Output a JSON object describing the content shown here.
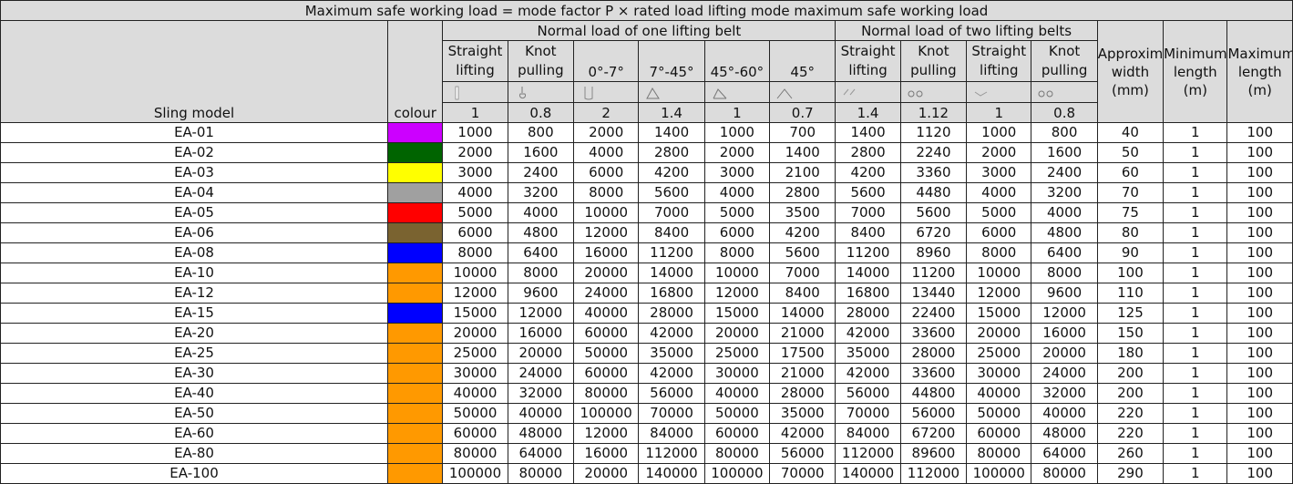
{
  "title": "Maximum safe working load = mode factor P × rated load lifting mode maximum safe working load",
  "groups": {
    "one_belt": "Normal load of one lifting belt",
    "two_belts": "Normal load of two lifting belts"
  },
  "headers": {
    "model": "Sling model",
    "colour": "colour",
    "width": "Approximate width (mm)",
    "min_length": "Minimum length (m)",
    "max_length": "Maximum length (m)"
  },
  "modes": [
    {
      "label": "Straight lifting",
      "factor": "1",
      "icon": "straight-lift-icon"
    },
    {
      "label": "Knot pulling",
      "factor": "0.8",
      "icon": "knot-pull-icon"
    },
    {
      "label": "0°-7°",
      "factor": "2",
      "icon": "basket-0-7-icon"
    },
    {
      "label": "7°-45°",
      "factor": "1.4",
      "icon": "basket-7-45-icon"
    },
    {
      "label": "45°-60°",
      "factor": "1",
      "icon": "basket-45-60-icon"
    },
    {
      "label": "45°",
      "factor": "0.7",
      "icon": "basket-45-icon"
    },
    {
      "label": "Straight lifting",
      "factor": "1.4",
      "icon": "two-straight-lift-icon"
    },
    {
      "label": "Knot pulling",
      "factor": "1.12",
      "icon": "two-knot-pull-icon"
    },
    {
      "label": "Straight lifting",
      "factor": "1",
      "icon": "two-straight-lift-b-icon"
    },
    {
      "label": "Knot pulling",
      "factor": "0.8",
      "icon": "two-knot-pull-b-icon"
    }
  ],
  "rows": [
    {
      "model": "EA-01",
      "color": "#cc00ff",
      "v": [
        "1000",
        "800",
        "2000",
        "1400",
        "1000",
        "700",
        "1400",
        "1120",
        "1000",
        "800"
      ],
      "width": "40",
      "min": "1",
      "max": "100"
    },
    {
      "model": "EA-02",
      "color": "#006400",
      "v": [
        "2000",
        "1600",
        "4000",
        "2800",
        "2000",
        "1400",
        "2800",
        "2240",
        "2000",
        "1600"
      ],
      "width": "50",
      "min": "1",
      "max": "100"
    },
    {
      "model": "EA-03",
      "color": "#ffff00",
      "v": [
        "3000",
        "2400",
        "6000",
        "4200",
        "3000",
        "2100",
        "4200",
        "3360",
        "3000",
        "2400"
      ],
      "width": "60",
      "min": "1",
      "max": "100"
    },
    {
      "model": "EA-04",
      "color": "#a0a0a0",
      "v": [
        "4000",
        "3200",
        "8000",
        "5600",
        "4000",
        "2800",
        "5600",
        "4480",
        "4000",
        "3200"
      ],
      "width": "70",
      "min": "1",
      "max": "100"
    },
    {
      "model": "EA-05",
      "color": "#ff0000",
      "v": [
        "5000",
        "4000",
        "10000",
        "7000",
        "5000",
        "3500",
        "7000",
        "5600",
        "5000",
        "4000"
      ],
      "width": "75",
      "min": "1",
      "max": "100"
    },
    {
      "model": "EA-06",
      "color": "#7a6330",
      "v": [
        "6000",
        "4800",
        "12000",
        "8400",
        "6000",
        "4200",
        "8400",
        "6720",
        "6000",
        "4800"
      ],
      "width": "80",
      "min": "1",
      "max": "100"
    },
    {
      "model": "EA-08",
      "color": "#0000ff",
      "v": [
        "8000",
        "6400",
        "16000",
        "11200",
        "8000",
        "5600",
        "11200",
        "8960",
        "8000",
        "6400"
      ],
      "width": "90",
      "min": "1",
      "max": "100"
    },
    {
      "model": "EA-10",
      "color": "#ff9900",
      "v": [
        "10000",
        "8000",
        "20000",
        "14000",
        "10000",
        "7000",
        "14000",
        "11200",
        "10000",
        "8000"
      ],
      "width": "100",
      "min": "1",
      "max": "100"
    },
    {
      "model": "EA-12",
      "color": "#ff9900",
      "v": [
        "12000",
        "9600",
        "24000",
        "16800",
        "12000",
        "8400",
        "16800",
        "13440",
        "12000",
        "9600"
      ],
      "width": "110",
      "min": "1",
      "max": "100"
    },
    {
      "model": "EA-15",
      "color": "#0000ff",
      "v": [
        "15000",
        "12000",
        "40000",
        "28000",
        "15000",
        "14000",
        "28000",
        "22400",
        "15000",
        "12000"
      ],
      "width": "125",
      "min": "1",
      "max": "100"
    },
    {
      "model": "EA-20",
      "color": "#ff9900",
      "v": [
        "20000",
        "16000",
        "60000",
        "42000",
        "20000",
        "21000",
        "42000",
        "33600",
        "20000",
        "16000"
      ],
      "width": "150",
      "min": "1",
      "max": "100"
    },
    {
      "model": "EA-25",
      "color": "#ff9900",
      "v": [
        "25000",
        "20000",
        "50000",
        "35000",
        "25000",
        "17500",
        "35000",
        "28000",
        "25000",
        "20000"
      ],
      "width": "180",
      "min": "1",
      "max": "100"
    },
    {
      "model": "EA-30",
      "color": "#ff9900",
      "v": [
        "30000",
        "24000",
        "60000",
        "42000",
        "30000",
        "21000",
        "42000",
        "33600",
        "30000",
        "24000"
      ],
      "width": "200",
      "min": "1",
      "max": "100"
    },
    {
      "model": "EA-40",
      "color": "#ff9900",
      "v": [
        "40000",
        "32000",
        "80000",
        "56000",
        "40000",
        "28000",
        "56000",
        "44800",
        "40000",
        "32000"
      ],
      "width": "200",
      "min": "1",
      "max": "100"
    },
    {
      "model": "EA-50",
      "color": "#ff9900",
      "v": [
        "50000",
        "40000",
        "100000",
        "70000",
        "50000",
        "35000",
        "70000",
        "56000",
        "50000",
        "40000"
      ],
      "width": "220",
      "min": "1",
      "max": "100"
    },
    {
      "model": "EA-60",
      "color": "#ff9900",
      "v": [
        "60000",
        "48000",
        "12000",
        "84000",
        "60000",
        "42000",
        "84000",
        "67200",
        "60000",
        "48000"
      ],
      "width": "220",
      "min": "1",
      "max": "100"
    },
    {
      "model": "EA-80",
      "color": "#ff9900",
      "v": [
        "80000",
        "64000",
        "16000",
        "112000",
        "80000",
        "56000",
        "112000",
        "89600",
        "80000",
        "64000"
      ],
      "width": "260",
      "min": "1",
      "max": "100"
    },
    {
      "model": "EA-100",
      "color": "#ff9900",
      "v": [
        "100000",
        "80000",
        "20000",
        "140000",
        "100000",
        "70000",
        "140000",
        "112000",
        "100000",
        "80000"
      ],
      "width": "290",
      "min": "1",
      "max": "100"
    }
  ]
}
